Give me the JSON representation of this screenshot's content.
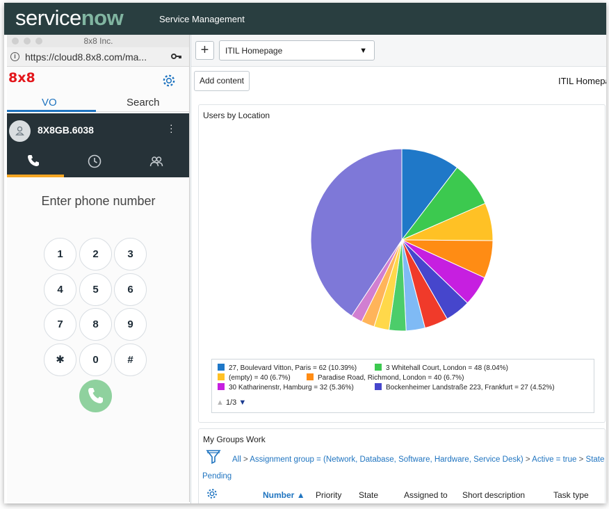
{
  "servicenow": {
    "logo_service": "service",
    "logo_now": "now",
    "subtitle": "Service Management",
    "plus_label": "+",
    "dashboard_select": "ITIL Homepage",
    "add_content": "Add content",
    "dashboard_title": "ITIL Homepage",
    "widget_users_title": "Users by Location",
    "legend": [
      {
        "label": "27, Boulevard Vitton, Paris = 62 (10.39%)",
        "color": "#1f78c8"
      },
      {
        "label": "3 Whitehall Court, London = 48 (8.04%)",
        "color": "#3cc94f"
      },
      {
        "label": "(empty) = 40 (6.7%)",
        "color": "#ffc125"
      },
      {
        "label": "Paradise Road, Richmond, London = 40 (6.7%)",
        "color": "#ff8c14"
      },
      {
        "label": "30 Katharinenstr, Hamburg = 32 (5.36%)",
        "color": "#c61fe0"
      },
      {
        "label": "Bockenheimer Landstraße 223, Frankfurt = 27 (4.52%)",
        "color": "#4646cc"
      }
    ],
    "pager": "1/3",
    "widget_groups_title": "My Groups Work",
    "breadcrumb": {
      "all": "All",
      "sep": ">",
      "assignment": "Assignment group = (Network, Database, Software, Hardware, Service Desk)",
      "active": "Active = true",
      "state": "State !=",
      "pending": "Pending"
    },
    "columns": [
      "Number",
      "Priority",
      "State",
      "Assigned to",
      "Short description",
      "Task type"
    ]
  },
  "chart_data": {
    "type": "pie",
    "title": "Users by Location",
    "slices": [
      {
        "label": "27, Boulevard Vitton, Paris",
        "value": 62,
        "percent": 10.39,
        "color": "#1f78c8"
      },
      {
        "label": "3 Whitehall Court, London",
        "value": 48,
        "percent": 8.04,
        "color": "#3cc94f"
      },
      {
        "label": "(empty)",
        "value": 40,
        "percent": 6.7,
        "color": "#ffc125"
      },
      {
        "label": "Paradise Road, Richmond, London",
        "value": 40,
        "percent": 6.7,
        "color": "#ff8c14"
      },
      {
        "label": "30 Katharinenstr, Hamburg",
        "value": 32,
        "percent": 5.36,
        "color": "#c61fe0"
      },
      {
        "label": "Bockenheimer Landstraße 223, Frankfurt",
        "value": 27,
        "percent": 4.52,
        "color": "#4646cc"
      },
      {
        "label": "",
        "value": 25,
        "color": "#f03a2a"
      },
      {
        "label": "",
        "value": 20,
        "color": "#7fbaf5"
      },
      {
        "label": "",
        "value": 18,
        "color": "#4ccd6a"
      },
      {
        "label": "",
        "value": 16,
        "color": "#ffd84a"
      },
      {
        "label": "",
        "value": 14,
        "color": "#ffb45a"
      },
      {
        "label": "",
        "value": 12,
        "color": "#d17fd1"
      },
      {
        "label": "",
        "value": 243,
        "color": "#7e78d8"
      }
    ],
    "legend_position": "bottom"
  },
  "softphone": {
    "window_title": "8x8 Inc.",
    "url": "https://cloud8.8x8.com/ma...",
    "brand": "8x8",
    "tabs": [
      "VO",
      "Search"
    ],
    "account": "8X8GB.6038",
    "prompt": "Enter phone number",
    "keys": [
      "1",
      "2",
      "3",
      "4",
      "5",
      "6",
      "7",
      "8",
      "9",
      "✱",
      "0",
      "#"
    ]
  }
}
